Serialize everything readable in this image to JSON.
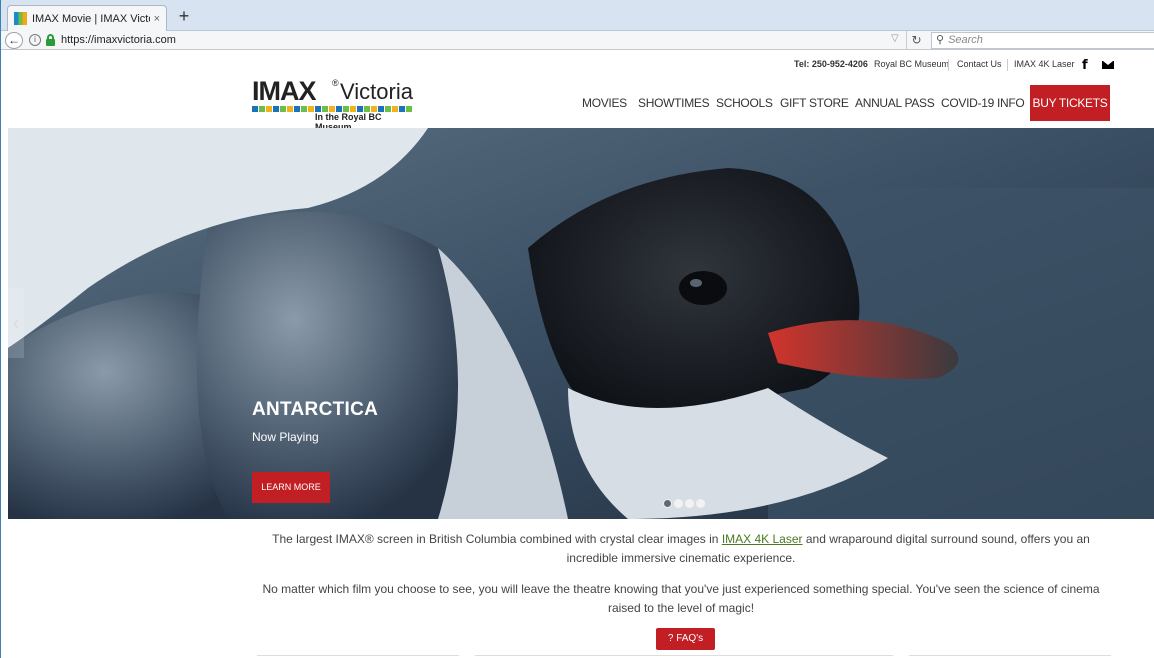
{
  "browser": {
    "tab_title": "IMAX Movie | IMAX Victoria",
    "tab_close": "×",
    "new_tab": "+",
    "url": "https://imaxvictoria.com",
    "search_placeholder": "Search"
  },
  "topbar": {
    "tel": "Tel: 250-952-4206",
    "links": [
      "Royal BC Museum",
      "Contact Us",
      "IMAX 4K Laser"
    ],
    "social_icons": [
      "facebook-icon",
      "mail-icon"
    ]
  },
  "logo": {
    "brand": "IMAX",
    "reg": "®",
    "city": "Victoria",
    "tagline": "In the Royal BC Museum"
  },
  "nav": {
    "items": [
      "MOVIES",
      "SHOWTIMES",
      "SCHOOLS",
      "GIFT STORE",
      "ANNUAL PASS",
      "COVID-19 INFO"
    ],
    "cta": "BUY TICKETS"
  },
  "hero": {
    "title": "ANTARCTICA",
    "subtitle": "Now Playing",
    "button": "LEARN MORE",
    "slide_count": 4,
    "active_slide": 1
  },
  "content": {
    "p1_before": "The largest IMAX® screen in British Columbia combined with crystal clear images in ",
    "p1_link": "IMAX 4K Laser",
    "p1_after": " and wraparound digital surround sound, offers you an incredible immersive cinematic experience.",
    "p2": "No matter which film you choose to see, you will leave the theatre knowing that you've just experienced something special. You've seen the science of cinema raised to the level of magic!",
    "faq_button": "? FAQ's"
  },
  "colors": {
    "accent_red": "#c21f24",
    "link_green": "#4a7a1f"
  }
}
